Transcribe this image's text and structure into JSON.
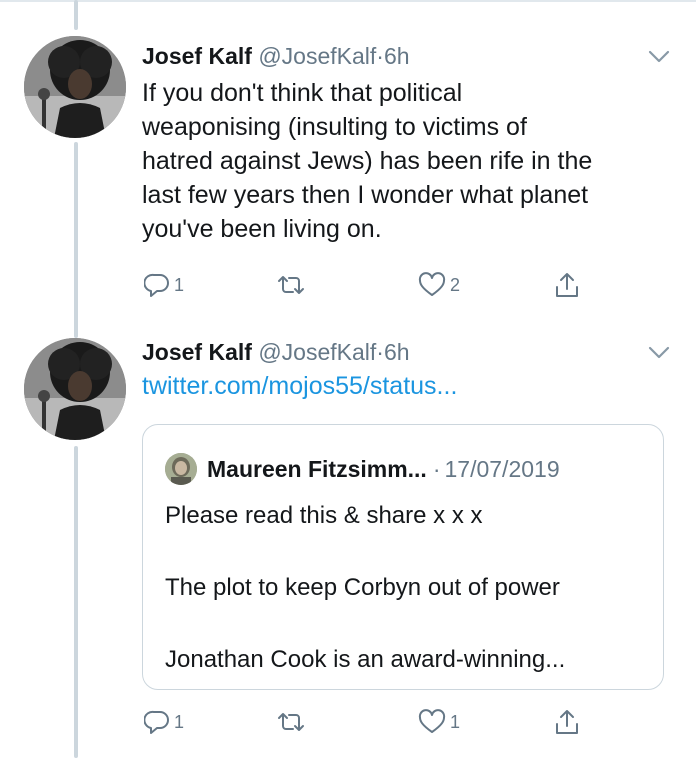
{
  "tweets": [
    {
      "author_name": "Josef Kalf",
      "author_handle": "@JosefKalf",
      "separator": "·",
      "time": "6h",
      "text_lines": [
        "If you don't think that political",
        "weaponising (insulting to victims of",
        "hatred against Jews) has been rife in the",
        "last few years then I wonder what planet",
        "you've been living on."
      ],
      "reply_count": "1",
      "retweet_count": "",
      "like_count": "2"
    },
    {
      "author_name": "Josef Kalf",
      "author_handle": "@JosefKalf",
      "separator": "·",
      "time": "6h",
      "link": "twitter.com/mojos55/status...",
      "quoted": {
        "author_name": "Maureen Fitzsimm...",
        "separator": "·",
        "date": "17/07/2019",
        "lines": [
          "Please read this & share x x x",
          "The plot to keep Corbyn out of power",
          "Jonathan Cook is an award-winning..."
        ]
      },
      "reply_count": "1",
      "retweet_count": "",
      "like_count": "1"
    }
  ],
  "icons": [
    "chevron-down-icon",
    "reply-icon",
    "retweet-icon",
    "like-icon",
    "share-icon"
  ],
  "colors": {
    "text": "#14171a",
    "secondary": "#657786",
    "link": "#1b95e0",
    "thread_line": "#ccd6dd",
    "border": "#ccd6dd"
  }
}
